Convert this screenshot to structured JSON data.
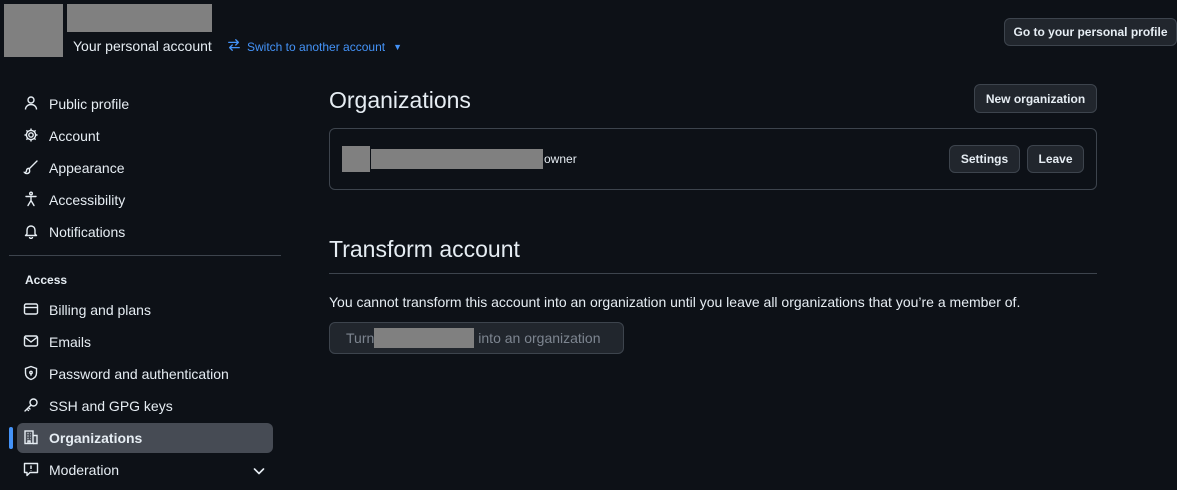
{
  "header": {
    "account_label": "Your personal account",
    "switch_label": "Switch to another account",
    "profile_button": "Go to your personal profile"
  },
  "sidebar": {
    "items": [
      {
        "label": "Public profile",
        "icon": "person-icon"
      },
      {
        "label": "Account",
        "icon": "gear-icon"
      },
      {
        "label": "Appearance",
        "icon": "paintbrush-icon"
      },
      {
        "label": "Accessibility",
        "icon": "accessibility-icon"
      },
      {
        "label": "Notifications",
        "icon": "bell-icon"
      }
    ],
    "section_label": "Access",
    "access_items": [
      {
        "label": "Billing and plans",
        "icon": "credit-card-icon"
      },
      {
        "label": "Emails",
        "icon": "mail-icon"
      },
      {
        "label": "Password and authentication",
        "icon": "shield-lock-icon"
      },
      {
        "label": "SSH and GPG keys",
        "icon": "key-icon"
      },
      {
        "label": "Organizations",
        "icon": "organization-icon",
        "active": true
      },
      {
        "label": "Moderation",
        "icon": "report-icon"
      }
    ]
  },
  "main": {
    "organizations_title": "Organizations",
    "new_org_button": "New organization",
    "org_role": "owner",
    "settings_button": "Settings",
    "leave_button": "Leave",
    "transform_title": "Transform account",
    "transform_note": "You cannot transform this account into an organization until you leave all organizations that you’re a member of.",
    "turn_prefix": "Turn",
    "turn_suffix": "into an organization"
  },
  "colors": {
    "background": "#0d1117",
    "accent": "#4493f8",
    "border": "#3d444d",
    "active_bg": "#464b54"
  }
}
